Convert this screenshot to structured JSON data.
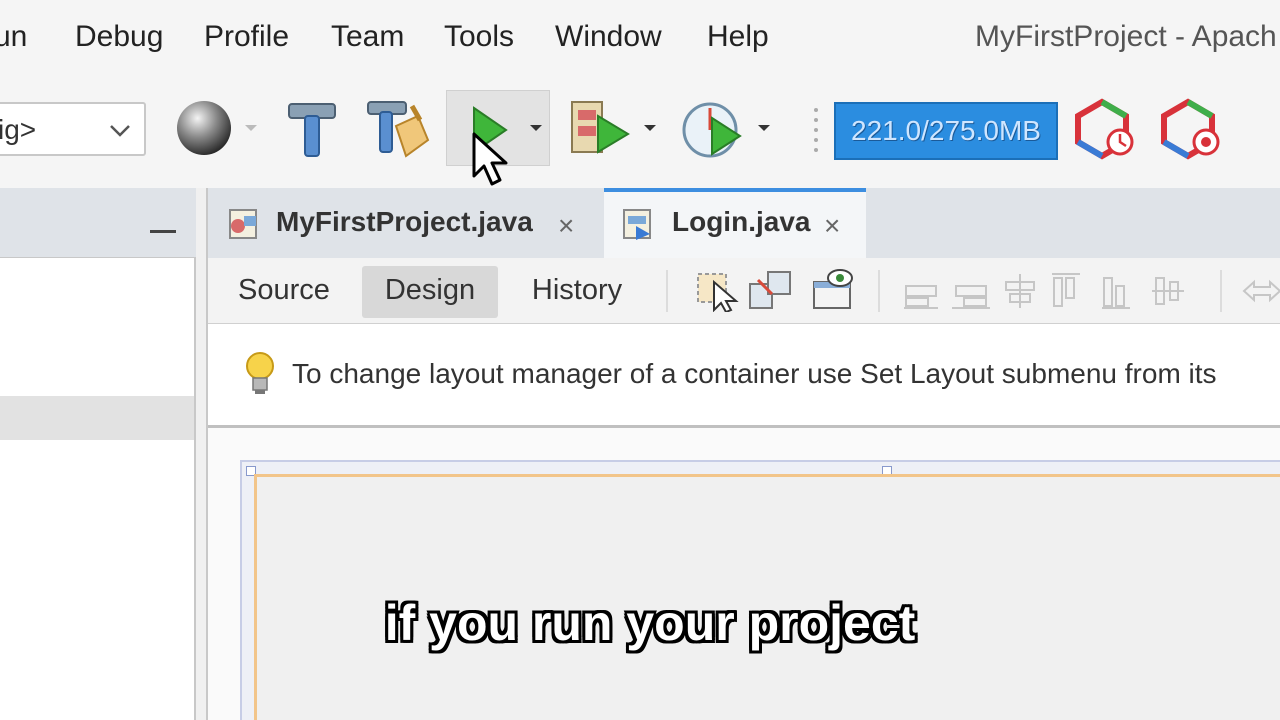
{
  "menubar": {
    "items": [
      {
        "label": "un"
      },
      {
        "label": "Debug"
      },
      {
        "label": "Profile"
      },
      {
        "label": "Team"
      },
      {
        "label": "Tools"
      },
      {
        "label": "Window"
      },
      {
        "label": "Help"
      }
    ],
    "window_title": "MyFirstProject - Apach"
  },
  "toolbar": {
    "config_value": "ig>",
    "memory": "221.0/275.0MB",
    "icons": [
      "globe-icon",
      "hammer-icon",
      "clean-build-icon",
      "run-icon",
      "debug-icon",
      "profile-icon",
      "gc-icon",
      "profiler-icon"
    ]
  },
  "editor": {
    "tabs": [
      {
        "label": "MyFirstProject.java",
        "close": "×"
      },
      {
        "label": "Login.java",
        "close": "×"
      }
    ],
    "views": [
      {
        "label": "Source"
      },
      {
        "label": "Design"
      },
      {
        "label": "History"
      }
    ],
    "hint": "To change layout manager of a container use Set Layout submenu from its"
  },
  "caption": "if you run your project",
  "colors": {
    "accent": "#3d8ee0",
    "memory_bar": "#2b8de0",
    "run_green": "#3fb63a"
  }
}
